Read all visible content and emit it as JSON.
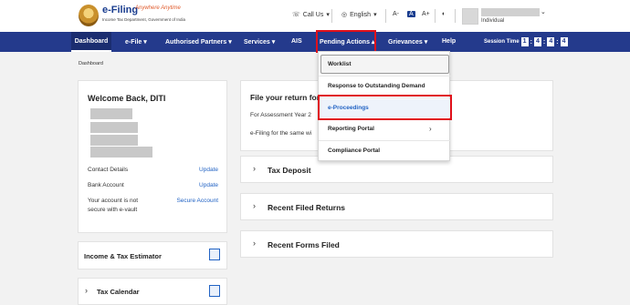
{
  "brand": {
    "name": "e-Filing",
    "tagline": "Anywhere Anytime",
    "sub": "Income Tax Department, Government of India"
  },
  "header": {
    "call_us": "Call Us",
    "language": "English",
    "font_minus": "A-",
    "font_default": "A",
    "font_plus": "A+",
    "user_role": "Individual"
  },
  "nav": {
    "items": [
      "Dashboard",
      "e-File",
      "Authorised Partners",
      "Services",
      "AIS",
      "Pending Actions",
      "Grievances",
      "Help"
    ],
    "session_label": "Session Time",
    "session_digits": [
      "1",
      "4",
      "4",
      "4"
    ]
  },
  "breadcrumb": "Dashboard",
  "welcome": {
    "title": "Welcome Back, DITI",
    "contact_label": "Contact Details",
    "contact_link": "Update",
    "bank_label": "Bank Account",
    "bank_link": "Update",
    "secure_label_1": "Your account is not",
    "secure_label_2": "secure with e-vault",
    "secure_link": "Secure Account"
  },
  "estimator": "Income & Tax Estimator",
  "tax_calendar": "Tax Calendar",
  "file_return": {
    "title": "File your return for t",
    "line1": "For Assessment Year 2",
    "line2": "e-Filing for the same wi"
  },
  "accordions": [
    "Tax Deposit",
    "Recent Filed Returns",
    "Recent Forms Filed"
  ],
  "dropdown": {
    "items": [
      "Worklist",
      "Response to Outstanding Demand",
      "e-Proceedings",
      "Reporting Portal",
      "Compliance Portal"
    ]
  },
  "colors": {
    "nav": "#243a8c",
    "highlight": "#e0101a",
    "link": "#2263c4"
  }
}
